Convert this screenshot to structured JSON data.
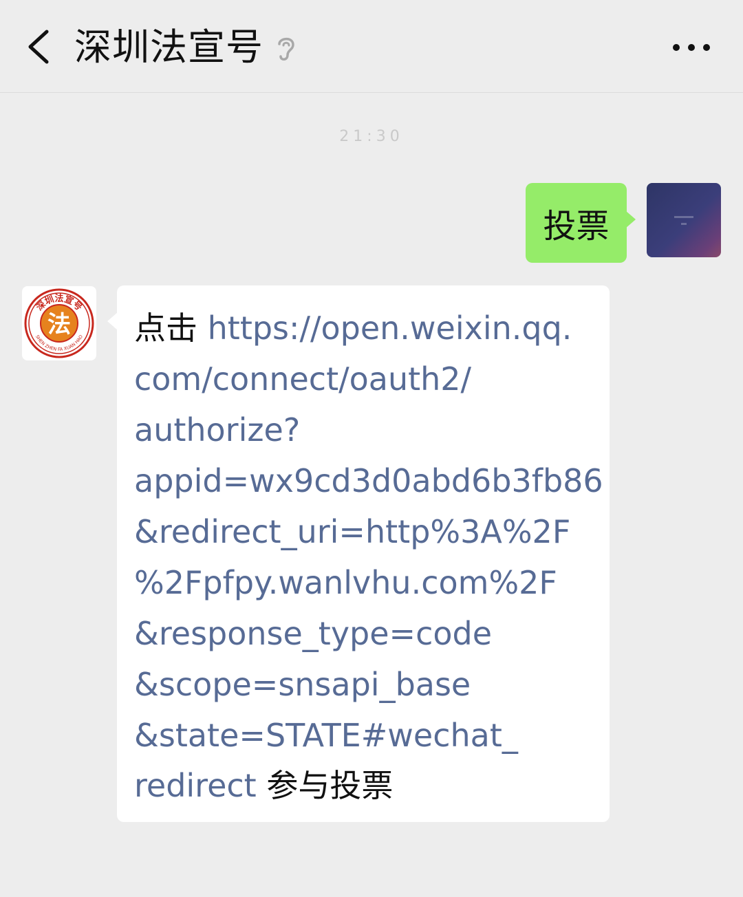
{
  "header": {
    "title": "深圳法宣号",
    "back_icon": "chevron-left-icon",
    "mute_icon": "ear-icon",
    "more_icon": "more-dots-icon"
  },
  "chat": {
    "timestamp": "21:30",
    "outgoing_message": "投票",
    "incoming_message": {
      "prefix": "点击",
      "link_lines": [
        "https://open.weixin.qq.",
        "com/connect/oauth2/",
        "authorize?",
        "appid=wx9cd3d0abd6b3fb86",
        "&redirect_uri=http%3A%2F",
        "%2Fpfpy.wanlvhu.com%2F",
        "&response_type=code",
        "&scope=snsapi_base",
        "&state=STATE#wechat_",
        "redirect"
      ],
      "suffix": "参与投票"
    },
    "official_avatar": {
      "name_text": "深圳法宣号",
      "english_text": "SHEN ZHEN FA XUAN HAO",
      "emblem_char": "法"
    }
  },
  "colors": {
    "background": "#ededed",
    "outgoing_bubble": "#95ec69",
    "incoming_bubble": "#ffffff",
    "link": "#576b95",
    "emblem_red": "#c8281e",
    "emblem_orange": "#e6821e"
  }
}
